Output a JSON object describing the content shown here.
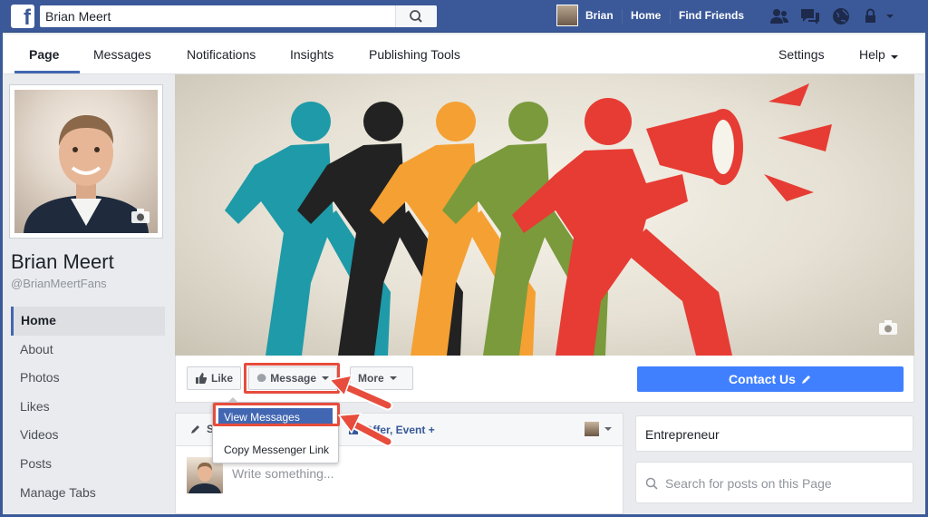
{
  "topbar": {
    "logo": "f",
    "search_value": "Brian Meert",
    "user_name": "Brian",
    "home_label": "Home",
    "find_friends_label": "Find Friends"
  },
  "page_nav": {
    "tabs": [
      "Page",
      "Messages",
      "Notifications",
      "Insights",
      "Publishing Tools"
    ],
    "settings_label": "Settings",
    "help_label": "Help"
  },
  "profile": {
    "name": "Brian Meert",
    "handle": "@BrianMeertFans"
  },
  "left_nav": {
    "items": [
      "Home",
      "About",
      "Photos",
      "Likes",
      "Videos",
      "Posts",
      "Manage Tabs"
    ]
  },
  "actions": {
    "like_label": "Like",
    "message_label": "Message",
    "more_label": "More",
    "contact_label": "Contact Us"
  },
  "message_dropdown": {
    "items": [
      "View Messages",
      "Copy Messenger Link"
    ]
  },
  "composer": {
    "status_label": "S",
    "offer_label": "Offer, Event +",
    "placeholder": "Write something..."
  },
  "about": {
    "category": "Entrepreneur"
  },
  "post_search": {
    "placeholder": "Search for posts on this Page"
  },
  "colors": {
    "brand_blue": "#3b5998",
    "cta_blue": "#4080ff",
    "highlight_red": "#e74c3c",
    "figure_teal": "#1e9aa8",
    "figure_black": "#222222",
    "figure_orange": "#f5a032",
    "figure_green": "#7a9a3c",
    "figure_red": "#e63c34"
  },
  "icons": [
    "facebook-logo-icon",
    "search-icon",
    "friend-requests-icon",
    "messages-icon",
    "globe-icon",
    "lock-icon",
    "camera-icon",
    "thumbs-up-icon",
    "messenger-icon",
    "pencil-icon",
    "offer-icon",
    "chevron-down-icon",
    "megaphone-icon"
  ]
}
